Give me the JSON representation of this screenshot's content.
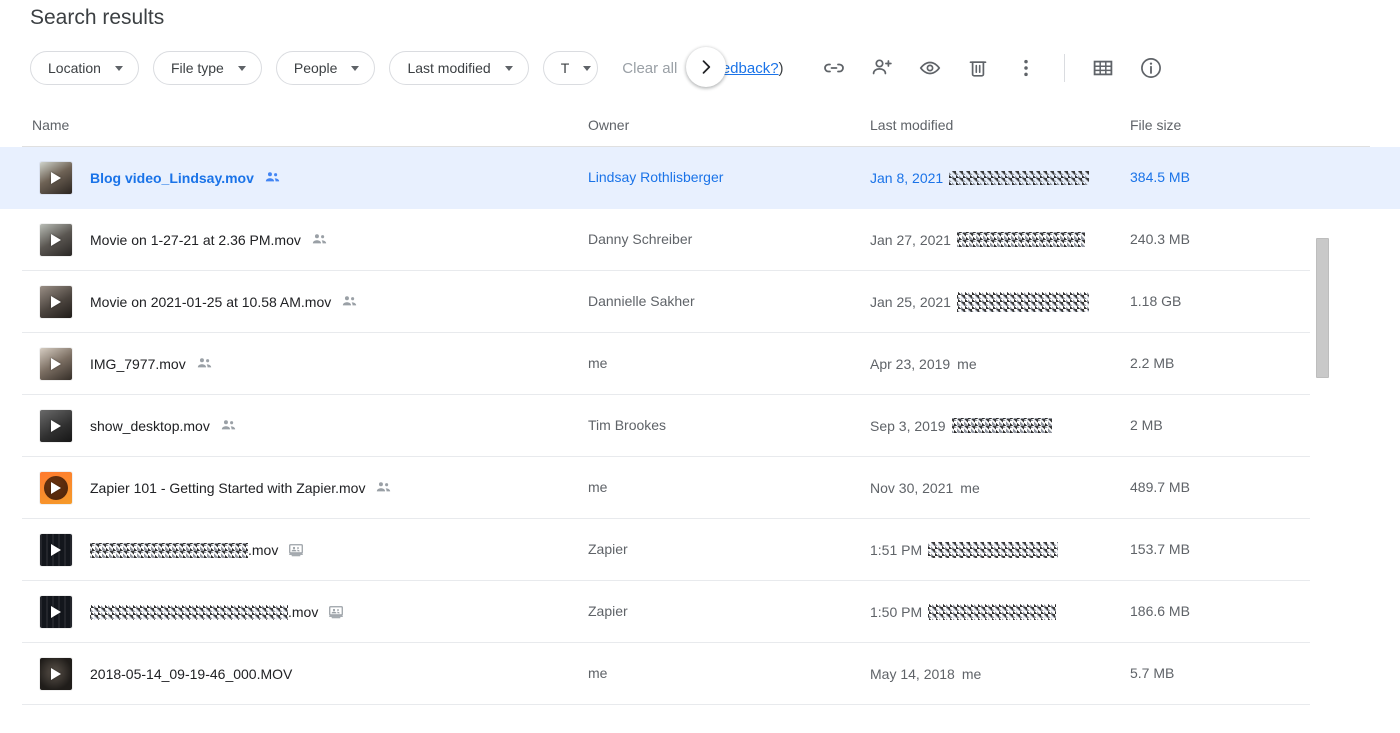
{
  "page": {
    "title": "Search results"
  },
  "toolbar": {
    "chips": [
      {
        "label": "Location",
        "icon": "chevron-down-icon"
      },
      {
        "label": "File type",
        "icon": "chevron-down-icon"
      },
      {
        "label": "People",
        "icon": "chevron-down-icon"
      },
      {
        "label": "Last modified",
        "icon": "chevron-down-icon"
      },
      {
        "label": "T",
        "icon": "chevron-down-icon"
      }
    ],
    "scroll_next_icon": "chevron-right-icon",
    "clear_all_label": "Clear all",
    "feedback_prefix": "(",
    "feedback_label": "Feedback?",
    "feedback_suffix": ")",
    "actions": [
      {
        "name": "get-link-button",
        "icon": "link-icon"
      },
      {
        "name": "share-button",
        "icon": "person-add-icon"
      },
      {
        "name": "preview-button",
        "icon": "eye-icon"
      },
      {
        "name": "remove-button",
        "icon": "trash-icon"
      },
      {
        "name": "more-actions-button",
        "icon": "more-vertical-icon"
      },
      {
        "name": "grid-view-button",
        "icon": "grid-view-icon"
      },
      {
        "name": "details-button",
        "icon": "info-icon"
      }
    ],
    "accent_color": "#1a73e8",
    "muted_color": "#5f6368"
  },
  "table": {
    "columns": [
      "Name",
      "Owner",
      "Last modified",
      "File size"
    ],
    "rows": [
      {
        "name": "Blog video_Lindsay.mov",
        "name_redacted": false,
        "share_icon": "people-shared-icon",
        "thumb": "video-thumbnail",
        "owner": "Lindsay Rothlisberger",
        "modified": "Jan 8, 2021",
        "modified_extra": "",
        "modified_redacted": true,
        "size": "384.5 MB",
        "selected": true
      },
      {
        "name": "Movie on 1-27-21 at 2.36 PM.mov",
        "name_redacted": false,
        "share_icon": "people-shared-icon",
        "thumb": "video-thumbnail",
        "owner": "Danny Schreiber",
        "modified": "Jan 27, 2021",
        "modified_extra": "",
        "modified_redacted": true,
        "size": "240.3 MB",
        "selected": false
      },
      {
        "name": "Movie on 2021-01-25 at 10.58 AM.mov",
        "name_redacted": false,
        "share_icon": "people-shared-icon",
        "thumb": "video-thumbnail",
        "owner": "Dannielle Sakher",
        "modified": "Jan 25, 2021",
        "modified_extra": "",
        "modified_redacted": true,
        "size": "1.18 GB",
        "selected": false
      },
      {
        "name": "IMG_7977.mov",
        "name_redacted": false,
        "share_icon": "people-shared-icon",
        "thumb": "video-thumbnail",
        "owner": "me",
        "modified": "Apr 23, 2019",
        "modified_extra": "me",
        "modified_redacted": false,
        "size": "2.2 MB",
        "selected": false
      },
      {
        "name": "show_desktop.mov",
        "name_redacted": false,
        "share_icon": "people-shared-icon",
        "thumb": "video-thumbnail",
        "owner": "Tim Brookes",
        "modified": "Sep 3, 2019",
        "modified_extra": "",
        "modified_redacted": true,
        "size": "2 MB",
        "selected": false
      },
      {
        "name": "Zapier 101 - Getting Started with Zapier.mov",
        "name_redacted": false,
        "share_icon": "people-shared-icon",
        "thumb": "zapier-thumbnail",
        "owner": "me",
        "modified": "Nov 30, 2021",
        "modified_extra": "me",
        "modified_redacted": false,
        "size": "489.7 MB",
        "selected": false
      },
      {
        "name": ".mov",
        "name_redacted": true,
        "share_icon": "shared-drive-icon",
        "thumb": "video-thumbnail",
        "owner": "Zapier",
        "modified": "1:51 PM",
        "modified_extra": "",
        "modified_redacted": true,
        "size": "153.7 MB",
        "selected": false
      },
      {
        "name": ".mov",
        "name_redacted": true,
        "share_icon": "shared-drive-icon",
        "thumb": "video-thumbnail",
        "owner": "Zapier",
        "modified": "1:50 PM",
        "modified_extra": "",
        "modified_redacted": true,
        "size": "186.6 MB",
        "selected": false
      },
      {
        "name": "2018-05-14_09-19-46_000.MOV",
        "name_redacted": false,
        "share_icon": "",
        "thumb": "video-thumbnail",
        "owner": "me",
        "modified": "May 14, 2018",
        "modified_extra": "me",
        "modified_redacted": false,
        "size": "5.7 MB",
        "selected": false
      }
    ]
  },
  "scrollbar": {
    "name": "vertical-scrollbar"
  }
}
